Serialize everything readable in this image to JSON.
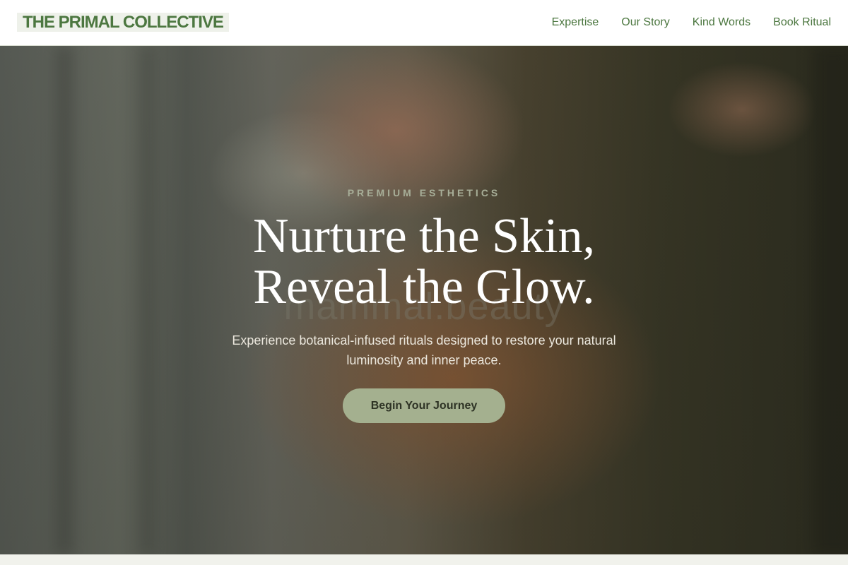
{
  "header": {
    "logo": "THE PRIMAL COLLECTIVE",
    "nav": [
      "Expertise",
      "Our Story",
      "Kind Words",
      "Book Ritual"
    ]
  },
  "hero": {
    "eyebrow": "PREMIUM ESTHETICS",
    "watermark": "mammal.beauty",
    "headline_line1": "Nurture the Skin,",
    "headline_line2": "Reveal the Glow.",
    "subtitle": "Experience botanical-infused rituals designed to restore your natural luminosity and inner peace.",
    "cta": "Begin Your Journey"
  },
  "colors": {
    "brand_green": "#4c7740",
    "cta_background": "#a4b08f",
    "eyebrow": "#a7ae98"
  }
}
